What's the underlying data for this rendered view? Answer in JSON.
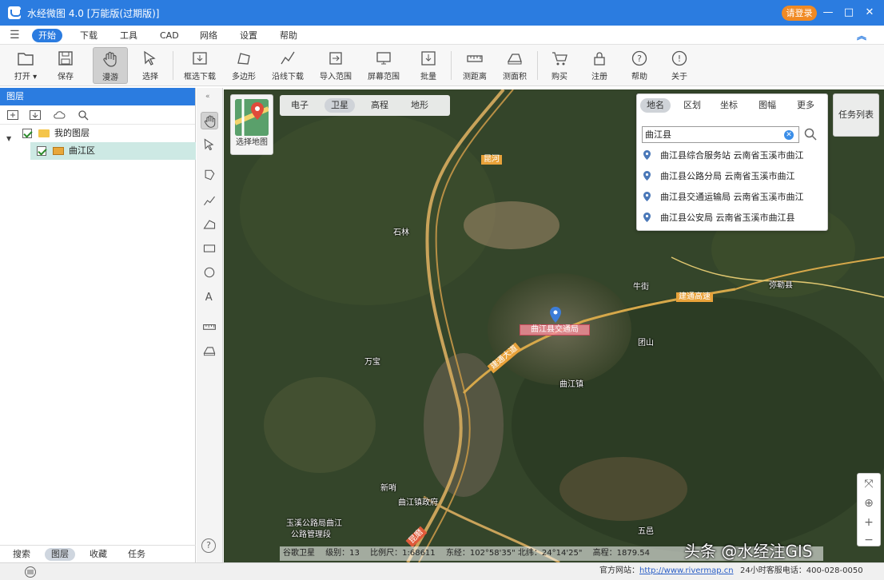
{
  "window": {
    "title": "水经微图 4.0 [万能版(过期版)]",
    "login_label": "请登录",
    "controls": {
      "minimize": "—",
      "maximize": "□",
      "close": "✕"
    }
  },
  "menubar": {
    "items": [
      {
        "label": "开始",
        "active": true
      },
      {
        "label": "下载",
        "active": false
      },
      {
        "label": "工具",
        "active": false
      },
      {
        "label": "CAD",
        "active": false
      },
      {
        "label": "网络",
        "active": false
      },
      {
        "label": "设置",
        "active": false
      },
      {
        "label": "帮助",
        "active": false
      }
    ]
  },
  "toolbar": {
    "tools": [
      {
        "label": "打开 ▾",
        "icon": "folder-open-icon"
      },
      {
        "label": "保存",
        "icon": "save-icon"
      },
      {
        "label": "漫游",
        "icon": "hand-pan-icon",
        "active": true
      },
      {
        "label": "选择",
        "icon": "select-arrow-icon"
      },
      {
        "label": "框选下载",
        "icon": "box-download-icon"
      },
      {
        "label": "多边形",
        "icon": "polygon-icon"
      },
      {
        "label": "沿线下载",
        "icon": "line-download-icon"
      },
      {
        "label": "导入范围",
        "icon": "import-range-icon"
      },
      {
        "label": "屏幕范围",
        "icon": "screen-range-icon"
      },
      {
        "label": "批量",
        "icon": "batch-icon"
      },
      {
        "label": "测距离",
        "icon": "measure-distance-icon"
      },
      {
        "label": "测面积",
        "icon": "measure-area-icon"
      },
      {
        "label": "购买",
        "icon": "cart-icon"
      },
      {
        "label": "注册",
        "icon": "lock-icon"
      },
      {
        "label": "帮助",
        "icon": "help-icon"
      },
      {
        "label": "关于",
        "icon": "info-icon"
      }
    ]
  },
  "left_panel": {
    "title": "图层",
    "tree": [
      {
        "label": "我的图层",
        "level": 0,
        "expanded": true,
        "checked": true
      },
      {
        "label": "曲江区",
        "level": 1,
        "checked": true,
        "selected": true
      }
    ],
    "tabs": [
      {
        "label": "搜索",
        "active": false
      },
      {
        "label": "图层",
        "active": true
      },
      {
        "label": "收藏",
        "active": false
      },
      {
        "label": "任务",
        "active": false
      }
    ]
  },
  "map": {
    "type_toggle_label": "选择地图",
    "layer_switch": [
      {
        "label": "电子",
        "active": false
      },
      {
        "label": "卫星",
        "active": true
      },
      {
        "label": "高程",
        "active": false
      },
      {
        "label": "地形",
        "active": false
      }
    ],
    "task_list_label": "任务列表",
    "search": {
      "tabs": [
        {
          "label": "地名",
          "active": true
        },
        {
          "label": "区划",
          "active": false
        },
        {
          "label": "坐标",
          "active": false
        },
        {
          "label": "图幅",
          "active": false
        },
        {
          "label": "更多",
          "active": false
        }
      ],
      "query": "曲江县",
      "results": [
        "曲江县综合服务站 云南省玉溪市曲江",
        "曲江县公路分局 云南省玉溪市曲江",
        "曲江县交通运输局 云南省玉溪市曲江",
        "曲江县公安局 云南省玉溪市曲江县"
      ]
    },
    "highlight_label": "曲江县交通局",
    "place_labels": [
      {
        "text": "石林",
        "kind": "place"
      },
      {
        "text": "曲江镇",
        "kind": "place"
      },
      {
        "text": "团山",
        "kind": "place"
      },
      {
        "text": "牛街",
        "kind": "place"
      },
      {
        "text": "弥勒县",
        "kind": "place"
      },
      {
        "text": "万宝",
        "kind": "place"
      },
      {
        "text": "新哨",
        "kind": "place"
      },
      {
        "text": "曲江镇政府",
        "kind": "place"
      },
      {
        "text": "玉溪公路局曲江",
        "kind": "place"
      },
      {
        "text": "公路管理段",
        "kind": "place"
      },
      {
        "text": "五邑",
        "kind": "place"
      },
      {
        "text": "昆河",
        "kind": "road"
      },
      {
        "text": "建通高速",
        "kind": "road"
      },
      {
        "text": "建通大道",
        "kind": "road"
      },
      {
        "text": "昆磨",
        "kind": "road-red"
      }
    ],
    "status": {
      "source": "谷歌卫星",
      "level_label": "级别：13",
      "scale_label": "比例尺：1:68611",
      "coords": "东经：102°58'35\"  北纬：24°14'25\"",
      "elevation": "高程：1879.54"
    },
    "zoom_controls": {
      "reset": "⤧",
      "locate": "⊕",
      "zoom_in": "+",
      "zoom_out": "−"
    }
  },
  "statusbar": {
    "site_prefix": "官方网站：",
    "site_url": "http://www.rivermap.cn",
    "phone": "24小时客服电话：400-028-0050"
  },
  "watermark": "头条 @水经注GIS"
}
